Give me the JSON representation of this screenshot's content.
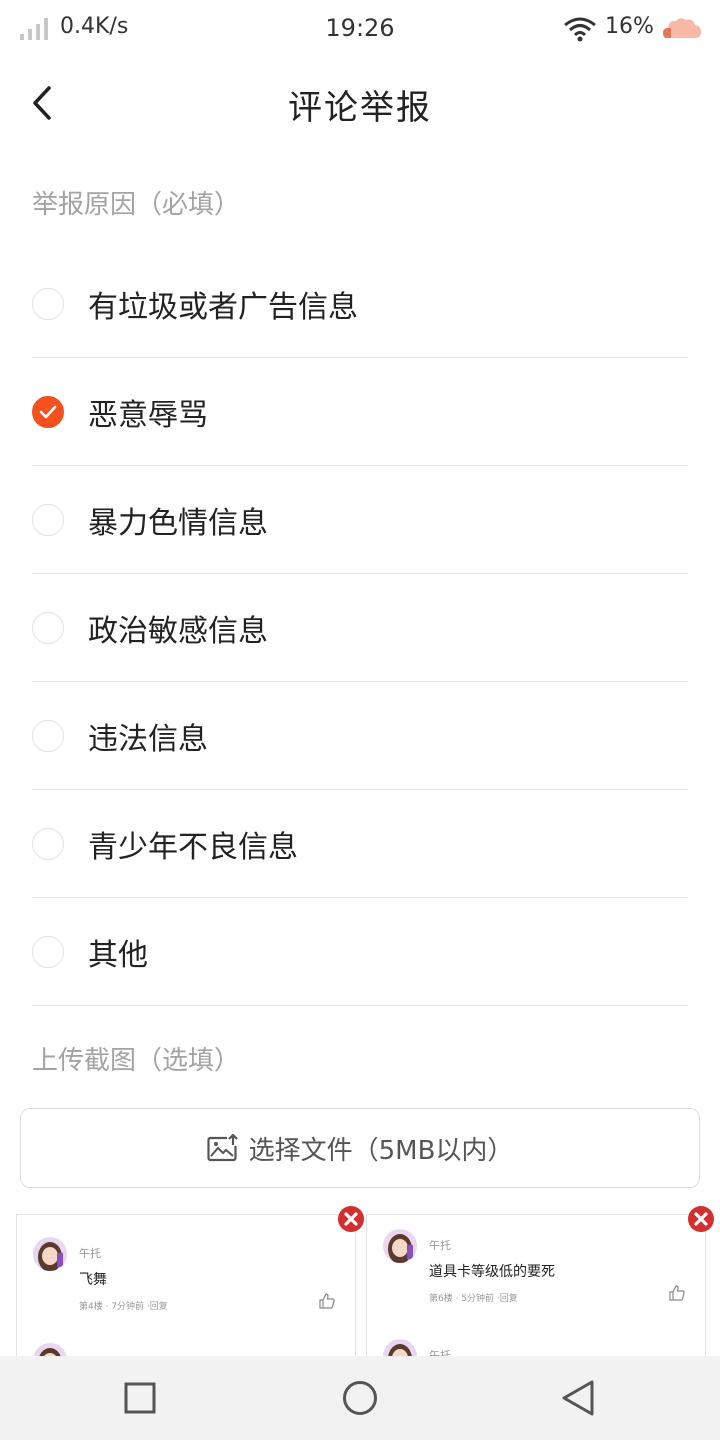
{
  "status_bar": {
    "network_speed": "0.4K/s",
    "time": "19:26",
    "battery_percent": "16%",
    "icons": [
      "signal-icon",
      "wifi-icon",
      "battery-icon"
    ]
  },
  "header": {
    "title": "评论举报",
    "back_icon": "chevron-left-icon"
  },
  "reason_section": {
    "label": "举报原因（必填）",
    "options": [
      {
        "label": "有垃圾或者广告信息",
        "checked": false
      },
      {
        "label": "恶意辱骂",
        "checked": true
      },
      {
        "label": "暴力色情信息",
        "checked": false
      },
      {
        "label": "政治敏感信息",
        "checked": false
      },
      {
        "label": "违法信息",
        "checked": false
      },
      {
        "label": "青少年不良信息",
        "checked": false
      },
      {
        "label": "其他",
        "checked": false
      }
    ]
  },
  "upload_section": {
    "label": "上传截图（选填）",
    "button_label": "选择文件（5MB以内）",
    "button_icon": "image-upload-icon"
  },
  "screenshots": [
    {
      "username": "午托",
      "comment": "飞舞",
      "meta": "第4楼 · 7分钟前 ·回复",
      "next_username": ""
    },
    {
      "username": "午托",
      "comment": "道具卡等级低的要死",
      "meta": "第6楼 · 5分钟前 ·回复",
      "next_username": "午托"
    }
  ],
  "nav_bar": {
    "icons": [
      "square-recents-icon",
      "circle-home-icon",
      "triangle-back-icon"
    ]
  },
  "colors": {
    "accent": "#f4511e",
    "remove": "#d32f2f",
    "section_label": "#a3a3a3",
    "divider": "#e6e6e6"
  }
}
